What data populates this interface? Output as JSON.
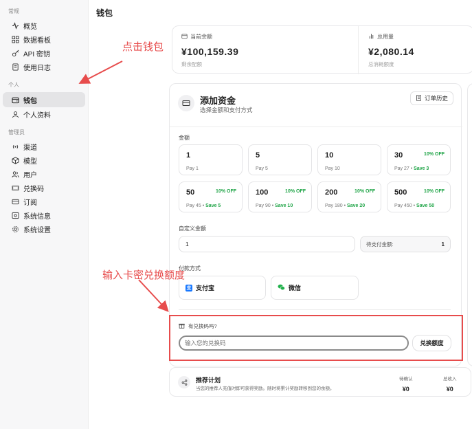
{
  "sidebar": {
    "sections": [
      {
        "label": "常规",
        "items": [
          {
            "label": "概览",
            "icon": "activity-icon"
          },
          {
            "label": "数据看板",
            "icon": "dashboard-grid-icon"
          },
          {
            "label": "API 密钥",
            "icon": "key-icon"
          },
          {
            "label": "使用日志",
            "icon": "document-icon"
          }
        ]
      },
      {
        "label": "个人",
        "items": [
          {
            "label": "钱包",
            "icon": "wallet-icon",
            "active": true
          },
          {
            "label": "个人资料",
            "icon": "user-icon"
          }
        ]
      },
      {
        "label": "管理员",
        "items": [
          {
            "label": "渠道",
            "icon": "radio-waves-icon"
          },
          {
            "label": "模型",
            "icon": "cube-icon"
          },
          {
            "label": "用户",
            "icon": "users-icon"
          },
          {
            "label": "兑换码",
            "icon": "ticket-icon"
          },
          {
            "label": "订阅",
            "icon": "card-icon"
          },
          {
            "label": "系统信息",
            "icon": "server-icon"
          },
          {
            "label": "系统设置",
            "icon": "gear-icon"
          }
        ]
      }
    ]
  },
  "page": {
    "title": "钱包"
  },
  "stats": {
    "balance": {
      "label": "当前余额",
      "value": "¥100,159.39",
      "sub": "剩余配额"
    },
    "usage": {
      "label": "总用量",
      "value": "¥2,080.14",
      "sub": "总消耗额度"
    }
  },
  "wallet": {
    "title": "添加资金",
    "subtitle": "选择金额和支付方式",
    "history_button": "订单历史",
    "amount_label": "金额",
    "amounts": [
      {
        "value": "1",
        "pay": "Pay 1",
        "off": "",
        "save": ""
      },
      {
        "value": "5",
        "pay": "Pay 5",
        "off": "",
        "save": ""
      },
      {
        "value": "10",
        "pay": "Pay 10",
        "off": "",
        "save": ""
      },
      {
        "value": "30",
        "pay": "Pay 27",
        "off": "10% OFF",
        "save": "Save 3"
      },
      {
        "value": "50",
        "pay": "Pay 45",
        "off": "10% OFF",
        "save": "Save 5"
      },
      {
        "value": "100",
        "pay": "Pay 90",
        "off": "10% OFF",
        "save": "Save 10"
      },
      {
        "value": "200",
        "pay": "Pay 180",
        "off": "10% OFF",
        "save": "Save 20"
      },
      {
        "value": "500",
        "pay": "Pay 450",
        "off": "10% OFF",
        "save": "Save 50"
      }
    ],
    "custom_label": "自定义金额",
    "custom_value": "1",
    "to_pay_label": "待支付金额:",
    "to_pay_value": "1",
    "payment_label": "付款方式",
    "payment_methods": [
      {
        "label": "支付宝",
        "icon": "alipay-icon"
      },
      {
        "label": "微信",
        "icon": "wechat-icon"
      }
    ],
    "redeem_label": "有兑换码吗?",
    "redeem_placeholder": "输入您的兑换码",
    "redeem_button": "兑换额度"
  },
  "referral": {
    "title": "推荐计划",
    "desc": "当您的推荐人充值时即可获得奖励。随时将累计奖励转移到您的余额。",
    "pending_label": "待确认",
    "pending_value": "¥0",
    "total_label": "总收入",
    "total_value": "¥0"
  },
  "annotations": {
    "click_wallet": "点击钱包",
    "enter_code": "输入卡密兑换额度",
    "color": "#e74c4c"
  }
}
